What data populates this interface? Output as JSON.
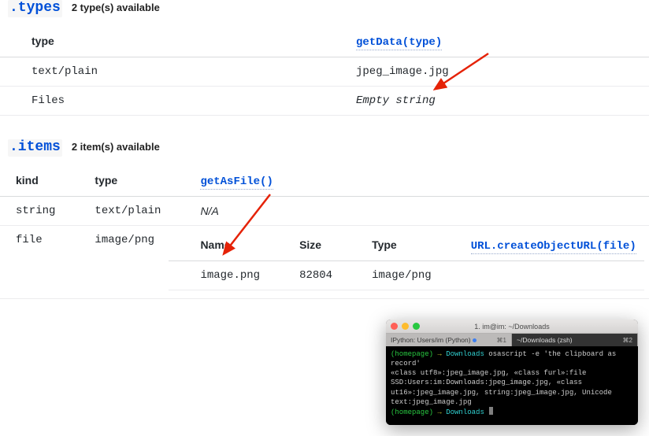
{
  "sections": {
    "types": {
      "heading": ".types",
      "subtitle": "2 type(s) available",
      "columns": {
        "type": "type",
        "getData": "getData(type)"
      },
      "rows": [
        {
          "type": "text/plain",
          "getData": "jpeg_image.jpg"
        },
        {
          "type": "Files",
          "getData": "Empty string"
        }
      ]
    },
    "items": {
      "heading": ".items",
      "subtitle": "2 item(s) available",
      "columns": {
        "kind": "kind",
        "type": "type",
        "getAsFile": "getAsFile()"
      },
      "rows": [
        {
          "kind": "string",
          "type": "text/plain",
          "getAsFile": "N/A"
        },
        {
          "kind": "file",
          "type": "image/png",
          "file": {
            "headers": {
              "name": "Name",
              "size": "Size",
              "type": "Type",
              "url": "URL.createObjectURL(file)"
            },
            "name": "image.png",
            "size": "82804",
            "ftype": "image/png"
          }
        }
      ]
    }
  },
  "terminal": {
    "title": "1. im@im: ~/Downloads",
    "tabs": [
      {
        "label": "IPython: Users/im (Python)",
        "shortcut": "⌘1"
      },
      {
        "label": "~/Downloads (zsh)",
        "shortcut": "⌘2"
      }
    ],
    "lines": {
      "prompt_host": "(homepage)",
      "arrow": "→",
      "cwd": "Downloads",
      "cmd": "osascript -e 'the clipboard as record'",
      "out": "«class utf8»:jpeg_image.jpg, «class furl»:file SSD:Users:im:Downloads:jpeg_image.jpg, «class ut16»:jpeg_image.jpg, string:jpeg_image.jpg, Unicode text:jpeg_image.jpg"
    }
  }
}
